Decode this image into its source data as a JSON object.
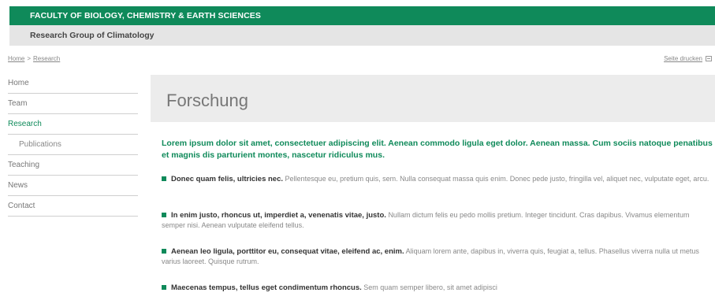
{
  "header": {
    "faculty": "FACULTY OF BIOLOGY, CHEMISTRY & EARTH SCIENCES",
    "group": "Research Group of Climatology"
  },
  "breadcrumb": {
    "home": "Home",
    "separator": ">",
    "current": "Research"
  },
  "sitemap": {
    "label": "Seite drucken",
    "icon": "print-icon"
  },
  "sidebar": {
    "items": [
      {
        "label": "Home"
      },
      {
        "label": "Team"
      },
      {
        "label": "Research"
      },
      {
        "label": "Publications"
      },
      {
        "label": "Teaching"
      },
      {
        "label": "News"
      },
      {
        "label": "Contact"
      }
    ]
  },
  "main": {
    "title": "Forschung",
    "lead": "Lorem ipsum dolor sit amet, consectetuer adipiscing elit. Aenean commodo ligula eget dolor. Aenean massa. Cum sociis natoque penatibus et magnis dis parturient montes, nascetur ridiculus mus.",
    "bullets": [
      {
        "strong": "Donec quam felis, ultricies nec.",
        "text": "Pellentesque eu, pretium quis, sem. Nulla consequat massa quis enim. Donec pede justo, fringilla vel, aliquet nec, vulputate eget, arcu."
      },
      {
        "strong": "In enim justo, rhoncus ut, imperdiet a, venenatis vitae, justo.",
        "text": "Nullam dictum felis eu pedo mollis pretium. Integer tincidunt. Cras dapibus. Vivamus elementum semper nisi. Aenean vulputate eleifend tellus."
      },
      {
        "strong": "Aenean leo ligula, porttitor eu, consequat vitae, eleifend ac, enim.",
        "text": "Aliquam lorem ante, dapibus in, viverra quis, feugiat a, tellus. Phasellus viverra nulla ut metus varius laoreet. Quisque rutrum."
      },
      {
        "strong": "Maecenas tempus, tellus eget condimentum rhoncus.",
        "text": "Sem quam semper libero, sit amet adipisci"
      }
    ]
  },
  "colors": {
    "accent": "#0f8a5a",
    "bar_gray": "#e5e5e5",
    "title_bg": "#ececec"
  }
}
